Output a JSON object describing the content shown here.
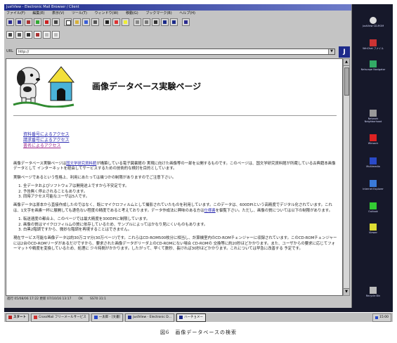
{
  "window": {
    "title": "JustView - Electronic Mail Browser / Client"
  },
  "menu": [
    "ファイル(F)",
    "編集(E)",
    "表示(V)",
    "ツール(T)",
    "ウィンドウ(W)",
    "移動(G)",
    "ブックマーク(B)",
    "ヘルプ(H)"
  ],
  "address": {
    "label": "URL",
    "value": "http://"
  },
  "page": {
    "title": "画像データベース実験ページ",
    "links": [
      "資料番号によるアクセス",
      "請求番号によるアクセス",
      "書名によるアクセス"
    ],
    "intro_before": "画像データベース実験ページは",
    "intro_link": "国文学研究資料館",
    "intro_after": "が構築している電子図書館の 実現に向けた画像等の一部を公開するものです。このページは、国文学研究資料館が所蔵している古典籍本画像データとして インターネットを経由してサービスするための技術的な検討を目的としています。",
    "limits_intro": "実験ページであるという性格上、利用にあたっては幾つかの制限がありますのでご注意下さい。",
    "limits": [
      "全データおよびソフトウェアは開発途上ですから不安定です。",
      "予告無く停止されることもあります。",
      "同時アクセス可能なユーザは5人です。"
    ],
    "data_para_before": "画像データは原本から直接作成したのではなく、既にマイクロフィルムとして撮影されていたものを利用しています。このデータは、600DPIという高精度でデジタル化されています。これは、1文字を画素一杯に展開しても遜色ない程度の精度であると考えております。データ作成法に興味のある方は",
    "data_para_link": "仕様書",
    "data_para_after": "を御覧下さい。ただし、画像の質については以下の制限があります。",
    "quality_limits": [
      "転送速度の都合上、このページでは最大精度を300DPIに制限しています。",
      "画像の質はマイクロフィルムの質に依存しているため、サンプルによってはかなり見にくいものもあります。",
      "白黒2階調ですから、微妙な階調を再現することはできません。"
    ],
    "service_para": "現在サービス可能な画像データは約30万コマ分(30万ページ)です。これらはCD-ROM500枚分に相当し、計算機室内のCD-ROMチェンジャーに収録されています。このCD-ROMチェンジャーには2台のCD-ROMリーダがあるだけですから、要求された画像データがリーダ上のCD-ROMにない場合 CD-ROMの 交換等に約20秒ほどかかります。また、ユーザからの要求に応じてフォーマットや精度を変換しているため、処理に 少々時間がかかります。したがって、早くて数秒、長ければ30秒ほどかかります。これについては早急に改善する 予定です。"
  },
  "statusbar": [
    "進行 05/08/06 17:22 更新 07/10/16 13:17",
    "OK",
    "SS70 31:1"
  ],
  "taskbar": {
    "start": "スタート",
    "tasks": [
      "CrossMail フリーメールサービス",
      "一太郎 - [文書]",
      "JustView - Electronic D...",
      "ハーチョメー"
    ],
    "active_index": 3,
    "clock": "15:00"
  },
  "desktop_icons": [
    "JustView CD-ROM",
    "WinChat ファイル",
    "Netscape Navigator",
    "Network Neighborhood",
    "Winsock",
    "Multimedia",
    "Internet Explorer",
    "Outlook",
    "Viewer",
    "Recycle Bin"
  ],
  "caption": "図6　画像データベースの検索"
}
